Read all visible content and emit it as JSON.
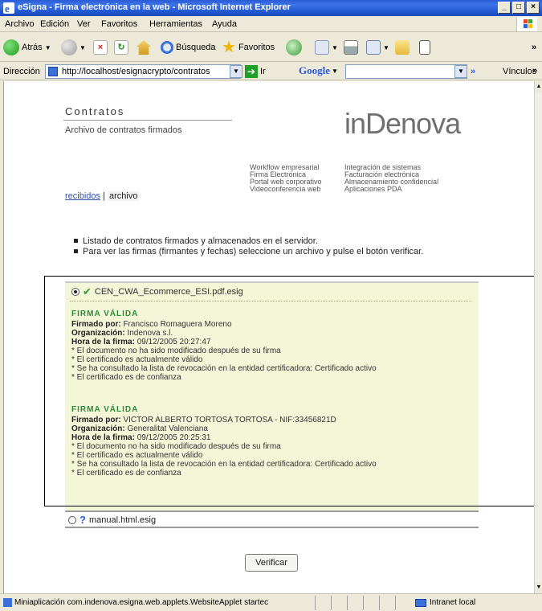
{
  "window": {
    "title": "eSigna - Firma electrónica en la web - Microsoft Internet Explorer",
    "minimize": "_",
    "maximize": "□",
    "close": "×"
  },
  "menu": [
    "Archivo",
    "Edición",
    "Ver",
    "Favoritos",
    "Herramientas",
    "Ayuda"
  ],
  "toolbar": {
    "back": "Atrás",
    "search": "Búsqueda",
    "favorites": "Favoritos",
    "more": "»"
  },
  "address": {
    "label": "Dirección",
    "url": "http://localhost/esignacrypto/contratos",
    "go": "Ir",
    "google": "Google",
    "links": "Vínculos",
    "more": "»"
  },
  "page": {
    "title": "Contratos",
    "subtitle": "Archivo de contratos firmados",
    "logo": "inDenova",
    "services_left": [
      "Workflow empresarial",
      "Firma Electrónica",
      "Portal web corporativo",
      "Videoconferencia web"
    ],
    "services_right": [
      "Integración de sistemas",
      "Facturación electrónica",
      "Almacenamiento confidencial",
      "Aplicaciones PDA"
    ],
    "nav_received": "recibidos",
    "nav_sep": "|",
    "nav_archive": "archivo",
    "bullet1": "Listado de contratos firmados y almacenados en el servidor.",
    "bullet2": "Para ver las firmas (firmantes y fechas) seleccione un archivo y pulse el botón verificar.",
    "verify_button": "Verificar"
  },
  "files": [
    {
      "name": "CEN_CWA_Ecommerce_ESI.pdf.esig",
      "selected": true
    },
    {
      "name": "manual.html.esig",
      "selected": false
    }
  ],
  "signatures": [
    {
      "status": "FIRMA VÁLIDA",
      "signed_by_label": "Firmado por:",
      "signed_by": "Francisco Romaguera Moreno",
      "org_label": "Organización:",
      "org": "Indenova s.l.",
      "time_label": "Hora de la firma:",
      "time": "09/12/2005 20:27:47",
      "checks": [
        "* El documento no ha sido modificado después de su firma",
        "* El certificado es actualmente válido",
        "* Se ha consultado la lista de revocación en la entidad certificadora: Certificado activo",
        "* El certificado es de confianza"
      ]
    },
    {
      "status": "FIRMA VÁLIDA",
      "signed_by_label": "Firmado por:",
      "signed_by": "VICTOR ALBERTO TORTOSA TORTOSA - NIF:33456821D",
      "org_label": "Organización:",
      "org": "Generalitat Valenciana",
      "time_label": "Hora de la firma:",
      "time": "09/12/2005 20:25:31",
      "checks": [
        "* El documento no ha sido modificado después de su firma",
        "* El certificado es actualmente válido",
        "* Se ha consultado la lista de revocación en la entidad certificadora: Certificado activo",
        "* El certificado es de confianza"
      ]
    }
  ],
  "status": {
    "text": "Miniaplicación com.indenova.esigna.web.applets.WebsiteApplet startec",
    "zone": "Intranet local"
  }
}
